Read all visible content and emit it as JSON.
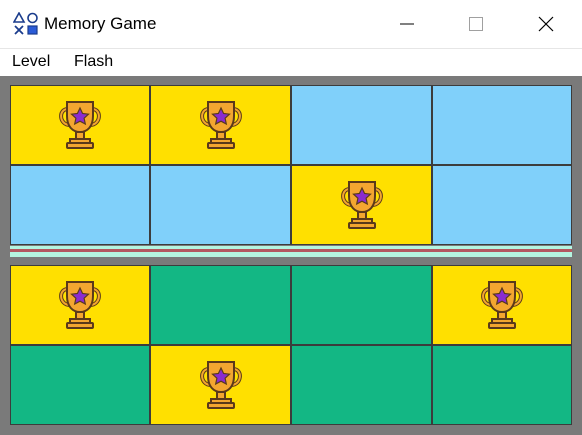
{
  "window": {
    "title": "Memory Game",
    "app_icon": "shapes-icon",
    "controls": [
      "minimize-icon",
      "maximize-icon",
      "close-icon"
    ]
  },
  "menu": {
    "items": [
      {
        "label": "Level"
      },
      {
        "label": "Flash"
      }
    ]
  },
  "board": {
    "background": "#7a7a7a",
    "colors": {
      "revealed": "#ffe000",
      "top_hidden": "#80d0fa",
      "bottom_hidden": "#13b784",
      "divider": "#b4f5e0",
      "divider_line": "#c0505a"
    },
    "top_grid": [
      [
        "trophy",
        "trophy",
        "hidden",
        "hidden"
      ],
      [
        "hidden",
        "hidden",
        "trophy",
        "hidden"
      ]
    ],
    "bottom_grid": [
      [
        "trophy",
        "hidden",
        "hidden",
        "trophy"
      ],
      [
        "hidden",
        "trophy",
        "hidden",
        "hidden"
      ]
    ],
    "tile_icon": "trophy-icon"
  }
}
